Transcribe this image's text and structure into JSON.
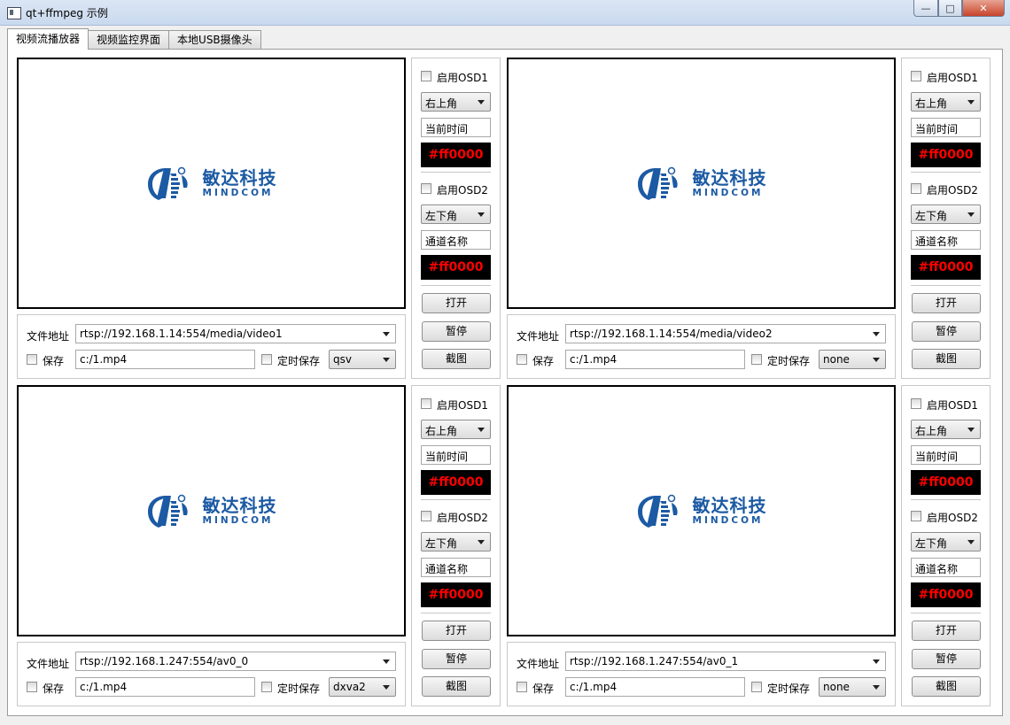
{
  "window": {
    "title": "qt+ffmpeg 示例",
    "min_glyph": "—",
    "max_glyph": "□",
    "close_glyph": "✕"
  },
  "tabs": [
    {
      "label": "视频流播放器",
      "active": true
    },
    {
      "label": "视频监控界面",
      "active": false
    },
    {
      "label": "本地USB摄像头",
      "active": false
    }
  ],
  "logo": {
    "cn": "敏达科技",
    "en": "MINDCOM"
  },
  "labels": {
    "file_address": "文件地址",
    "save": "保存",
    "timed_save": "定时保存"
  },
  "players": [
    {
      "url": "rtsp://192.168.1.14:554/media/video1",
      "save_path": "c:/1.mp4",
      "decoder": "qsv"
    },
    {
      "url": "rtsp://192.168.1.14:554/media/video2",
      "save_path": "c:/1.mp4",
      "decoder": "none"
    },
    {
      "url": "rtsp://192.168.1.247:554/av0_0",
      "save_path": "c:/1.mp4",
      "decoder": "dxva2"
    },
    {
      "url": "rtsp://192.168.1.247:554/av0_1",
      "save_path": "c:/1.mp4",
      "decoder": "none"
    }
  ],
  "osd": {
    "osd1": {
      "label": "启用OSD1",
      "position": "右上角",
      "text": "当前时间",
      "color": "#ff0000"
    },
    "osd2": {
      "label": "启用OSD2",
      "position": "左下角",
      "text": "通道名称",
      "color": "#ff0000"
    }
  },
  "buttons": {
    "open": "打开",
    "pause": "暂停",
    "snapshot": "截图"
  }
}
